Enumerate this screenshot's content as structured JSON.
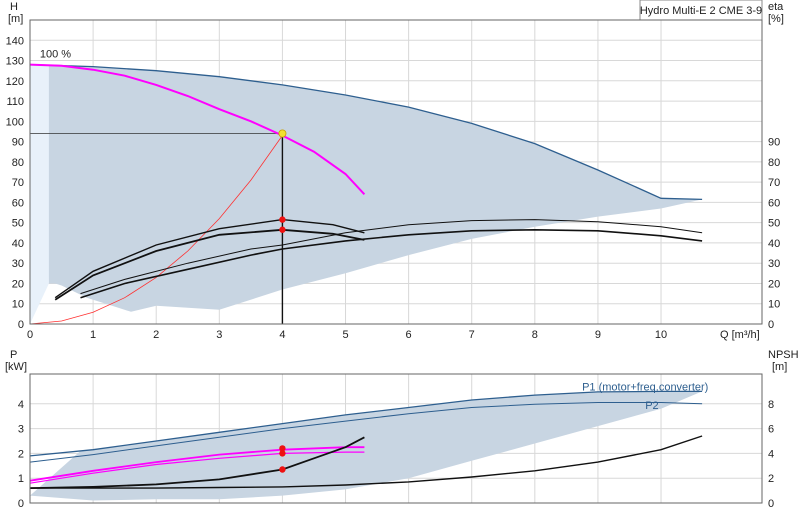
{
  "chart_data": [
    {
      "type": "line",
      "name": "pump-curve-top",
      "title": "Hydro Multi-E 2 CME 3-9",
      "x_axis": {
        "label": "Q [m³/h]",
        "lim": [
          0,
          11.6
        ],
        "ticks": [
          0,
          1,
          2,
          3,
          4,
          5,
          6,
          7,
          8,
          9,
          10
        ]
      },
      "y_left": {
        "label_line1": "H",
        "label_line2": "[m]",
        "lim": [
          0,
          150
        ],
        "ticks": [
          0,
          10,
          20,
          30,
          40,
          50,
          60,
          70,
          80,
          90,
          100,
          110,
          120,
          130,
          140
        ]
      },
      "y_right": {
        "label_line1": "eta",
        "label_line2": "[%]",
        "lim": [
          0,
          150
        ],
        "ticks": [
          0,
          10,
          20,
          30,
          40,
          50,
          60,
          70,
          80,
          90
        ]
      },
      "grid": true,
      "annotations": [
        {
          "text": "100 %",
          "x": 0.6,
          "y": 130
        }
      ],
      "operating_point": {
        "x": 4,
        "y": 94,
        "color": "#f2e030"
      },
      "eta_points": [
        {
          "x": 4,
          "y": 51.5
        },
        {
          "x": 4,
          "y": 46.5
        }
      ],
      "area": {
        "color": "#c8d5e2",
        "upper": [
          [
            0.3,
            128
          ],
          [
            1,
            127
          ],
          [
            2,
            125
          ],
          [
            3,
            122
          ],
          [
            4,
            118
          ],
          [
            5,
            113
          ],
          [
            6,
            107
          ],
          [
            7,
            99
          ],
          [
            8,
            89
          ],
          [
            9,
            76
          ],
          [
            10,
            62
          ],
          [
            10.65,
            61.5
          ]
        ],
        "lower": [
          [
            10.65,
            61.5
          ],
          [
            10,
            57
          ],
          [
            9,
            53
          ],
          [
            8,
            48
          ],
          [
            7,
            42
          ],
          [
            6,
            34
          ],
          [
            5,
            25
          ],
          [
            4,
            17
          ],
          [
            3,
            7
          ],
          [
            2,
            9
          ],
          [
            1.6,
            6
          ],
          [
            1.4,
            8
          ],
          [
            0.9,
            13
          ],
          [
            0.5,
            19
          ],
          [
            0.4,
            20
          ],
          [
            0.3,
            20
          ]
        ]
      },
      "series": [
        {
          "kind": "max-curve",
          "color": "#2e5f8f",
          "width": 1.3,
          "points": [
            [
              0,
              128
            ],
            [
              1,
              127
            ],
            [
              2,
              125
            ],
            [
              3,
              122
            ],
            [
              4,
              118
            ],
            [
              5,
              113
            ],
            [
              6,
              107
            ],
            [
              7,
              99
            ],
            [
              8,
              89
            ],
            [
              9,
              76
            ],
            [
              10,
              62
            ],
            [
              10.65,
              61.5
            ]
          ]
        },
        {
          "kind": "pump-curve",
          "color": "#ff00ff",
          "width": 2,
          "points": [
            [
              0,
              128
            ],
            [
              0.5,
              127.4
            ],
            [
              1,
              125.5
            ],
            [
              1.5,
              122.5
            ],
            [
              2,
              118
            ],
            [
              2.5,
              112.5
            ],
            [
              3,
              106
            ],
            [
              3.5,
              100
            ],
            [
              4,
              93
            ],
            [
              4.5,
              85
            ],
            [
              5,
              74
            ],
            [
              5.3,
              64
            ]
          ]
        },
        {
          "kind": "system-curve",
          "color": "#ff3030",
          "width": 0.8,
          "points": [
            [
              0,
              0
            ],
            [
              0.5,
              1.5
            ],
            [
              1,
              5.8
            ],
            [
              1.5,
              13
            ],
            [
              2,
              23
            ],
            [
              2.5,
              36
            ],
            [
              3,
              52
            ],
            [
              3.5,
              71
            ],
            [
              4,
              93
            ]
          ]
        },
        {
          "kind": "eta-upper",
          "color": "#111111",
          "width": 1.4,
          "points": [
            [
              0.4,
              13
            ],
            [
              1,
              26
            ],
            [
              2,
              39
            ],
            [
              3,
              47
            ],
            [
              4,
              51.5
            ],
            [
              4.8,
              49
            ],
            [
              5.3,
              45
            ]
          ]
        },
        {
          "kind": "eta-lower",
          "color": "#111111",
          "width": 1.8,
          "points": [
            [
              0.4,
              12
            ],
            [
              1,
              24
            ],
            [
              2,
              36
            ],
            [
              3,
              44
            ],
            [
              4,
              46.5
            ],
            [
              4.8,
              44.5
            ],
            [
              5.3,
              41.5
            ]
          ]
        },
        {
          "kind": "eta-max-upper",
          "color": "#111111",
          "width": 1,
          "points": [
            [
              0.8,
              15
            ],
            [
              1.5,
              22
            ],
            [
              2.5,
              30
            ],
            [
              3.5,
              37
            ],
            [
              4,
              39
            ],
            [
              5,
              45
            ],
            [
              6,
              49
            ],
            [
              7,
              51
            ],
            [
              8,
              51.5
            ],
            [
              9,
              50.5
            ],
            [
              10,
              48
            ],
            [
              10.65,
              45
            ]
          ]
        },
        {
          "kind": "eta-max-lower",
          "color": "#111111",
          "width": 1.6,
          "points": [
            [
              0.8,
              13
            ],
            [
              1.5,
              20
            ],
            [
              2.5,
              27
            ],
            [
              3.5,
              34
            ],
            [
              4,
              37
            ],
            [
              5,
              41
            ],
            [
              6,
              44
            ],
            [
              7,
              46
            ],
            [
              8,
              46.5
            ],
            [
              9,
              46
            ],
            [
              10,
              43.5
            ],
            [
              10.65,
              41
            ]
          ]
        }
      ]
    },
    {
      "type": "line",
      "name": "power-npsh-bottom",
      "x_axis": {
        "lim": [
          0,
          11.6
        ],
        "ticks": []
      },
      "y_left": {
        "label_line1": "P",
        "label_line2": "[kW]",
        "lim": [
          0,
          5.2
        ],
        "ticks": [
          0,
          1,
          2,
          3,
          4
        ]
      },
      "y_right": {
        "label_line1": "NPSH",
        "label_line2": "[m]",
        "lim": [
          0,
          10.4
        ],
        "ticks": [
          0,
          2,
          4,
          6,
          8
        ]
      },
      "grid": true,
      "labels": [
        {
          "text": "P1 (motor+freq.converter)",
          "x": 9.7,
          "y": 4.7
        },
        {
          "text": "P2",
          "x": 10.7,
          "y": 3.95
        }
      ],
      "area": {
        "color": "#c8d5e2",
        "upper": [
          [
            0.8,
            2.1
          ],
          [
            2,
            2.5
          ],
          [
            3,
            2.85
          ],
          [
            4,
            3.2
          ],
          [
            5,
            3.55
          ],
          [
            6,
            3.85
          ],
          [
            7,
            4.15
          ],
          [
            8,
            4.35
          ],
          [
            9,
            4.48
          ],
          [
            10,
            4.5
          ],
          [
            10.65,
            4.5
          ]
        ],
        "lower": [
          [
            10.65,
            4.5
          ],
          [
            10,
            3.8
          ],
          [
            9,
            3.1
          ],
          [
            8,
            2.4
          ],
          [
            7,
            1.7
          ],
          [
            6,
            1.0
          ],
          [
            5,
            0.55
          ],
          [
            4,
            0.3
          ],
          [
            3,
            0.15
          ],
          [
            2,
            0.15
          ],
          [
            1,
            0.1
          ],
          [
            0,
            0.3
          ]
        ]
      },
      "series": [
        {
          "kind": "P1-max",
          "color": "#2e5f8f",
          "width": 1.3,
          "points": [
            [
              0,
              1.9
            ],
            [
              1,
              2.15
            ],
            [
              2,
              2.5
            ],
            [
              3,
              2.85
            ],
            [
              4,
              3.2
            ],
            [
              5,
              3.55
            ],
            [
              6,
              3.85
            ],
            [
              7,
              4.15
            ],
            [
              8,
              4.35
            ],
            [
              9,
              4.48
            ],
            [
              10,
              4.5
            ],
            [
              10.65,
              4.5
            ]
          ]
        },
        {
          "kind": "P2-max",
          "color": "#2e5f8f",
          "width": 1,
          "points": [
            [
              0,
              1.65
            ],
            [
              1,
              1.95
            ],
            [
              2,
              2.3
            ],
            [
              3,
              2.65
            ],
            [
              4,
              3.0
            ],
            [
              5,
              3.3
            ],
            [
              6,
              3.6
            ],
            [
              7,
              3.85
            ],
            [
              8,
              3.98
            ],
            [
              9,
              4.05
            ],
            [
              10,
              4.05
            ],
            [
              10.65,
              4.0
            ]
          ]
        },
        {
          "kind": "P1",
          "color": "#ff00ff",
          "width": 1.8,
          "points": [
            [
              0,
              0.9
            ],
            [
              1,
              1.3
            ],
            [
              2,
              1.65
            ],
            [
              3,
              1.95
            ],
            [
              4,
              2.15
            ],
            [
              5,
              2.25
            ],
            [
              5.3,
              2.25
            ]
          ]
        },
        {
          "kind": "P2",
          "color": "#ff00ff",
          "width": 1.2,
          "points": [
            [
              0,
              0.8
            ],
            [
              1,
              1.2
            ],
            [
              2,
              1.55
            ],
            [
              3,
              1.8
            ],
            [
              4,
              2.0
            ],
            [
              5,
              2.05
            ],
            [
              5.3,
              2.05
            ]
          ]
        },
        {
          "kind": "NPSH-current",
          "color": "#111111",
          "width": 1.8,
          "axis": "right",
          "points": [
            [
              0,
              1.2
            ],
            [
              1,
              1.3
            ],
            [
              2,
              1.5
            ],
            [
              3,
              1.9
            ],
            [
              4,
              2.7
            ],
            [
              4.5,
              3.6
            ],
            [
              5,
              4.5
            ],
            [
              5.3,
              5.3
            ]
          ]
        },
        {
          "kind": "NPSH-max",
          "color": "#111111",
          "width": 1.4,
          "axis": "right",
          "points": [
            [
              0,
              1.2
            ],
            [
              2,
              1.2
            ],
            [
              3,
              1.25
            ],
            [
              4,
              1.3
            ],
            [
              5,
              1.45
            ],
            [
              6,
              1.7
            ],
            [
              7,
              2.1
            ],
            [
              8,
              2.6
            ],
            [
              9,
              3.3
            ],
            [
              10,
              4.3
            ],
            [
              10.65,
              5.4
            ]
          ]
        }
      ],
      "points": [
        {
          "x": 4,
          "y": 2.2,
          "axis": "left"
        },
        {
          "x": 4,
          "y": 2.0,
          "axis": "left"
        },
        {
          "x": 4,
          "y": 2.7,
          "axis": "right"
        }
      ]
    }
  ]
}
